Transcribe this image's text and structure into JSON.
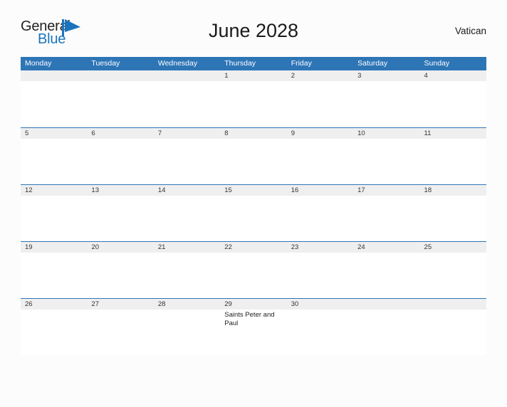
{
  "brand": {
    "name_part1": "General",
    "name_part2": "Blue",
    "flag_icon": "triangle-flag-icon",
    "color_primary": "#1b74bc",
    "color_text": "#231f20"
  },
  "header": {
    "title": "June 2028",
    "region": "Vatican"
  },
  "theme": {
    "header_bg": "#2e75b6",
    "header_text": "#ffffff",
    "date_band_bg": "#efefef",
    "cell_bg": "#ffffff",
    "page_bg": "#fcfcfd",
    "row_divider": "#2e75b6"
  },
  "calendar": {
    "weekdays": [
      "Monday",
      "Tuesday",
      "Wednesday",
      "Thursday",
      "Friday",
      "Saturday",
      "Sunday"
    ],
    "weeks": [
      [
        {
          "date": "",
          "events": []
        },
        {
          "date": "",
          "events": []
        },
        {
          "date": "",
          "events": []
        },
        {
          "date": "1",
          "events": []
        },
        {
          "date": "2",
          "events": []
        },
        {
          "date": "3",
          "events": []
        },
        {
          "date": "4",
          "events": []
        }
      ],
      [
        {
          "date": "5",
          "events": []
        },
        {
          "date": "6",
          "events": []
        },
        {
          "date": "7",
          "events": []
        },
        {
          "date": "8",
          "events": []
        },
        {
          "date": "9",
          "events": []
        },
        {
          "date": "10",
          "events": []
        },
        {
          "date": "11",
          "events": []
        }
      ],
      [
        {
          "date": "12",
          "events": []
        },
        {
          "date": "13",
          "events": []
        },
        {
          "date": "14",
          "events": []
        },
        {
          "date": "15",
          "events": []
        },
        {
          "date": "16",
          "events": []
        },
        {
          "date": "17",
          "events": []
        },
        {
          "date": "18",
          "events": []
        }
      ],
      [
        {
          "date": "19",
          "events": []
        },
        {
          "date": "20",
          "events": []
        },
        {
          "date": "21",
          "events": []
        },
        {
          "date": "22",
          "events": []
        },
        {
          "date": "23",
          "events": []
        },
        {
          "date": "24",
          "events": []
        },
        {
          "date": "25",
          "events": []
        }
      ],
      [
        {
          "date": "26",
          "events": []
        },
        {
          "date": "27",
          "events": []
        },
        {
          "date": "28",
          "events": []
        },
        {
          "date": "29",
          "events": [
            "Saints Peter and Paul"
          ]
        },
        {
          "date": "30",
          "events": []
        },
        {
          "date": "",
          "events": []
        },
        {
          "date": "",
          "events": []
        }
      ]
    ]
  }
}
